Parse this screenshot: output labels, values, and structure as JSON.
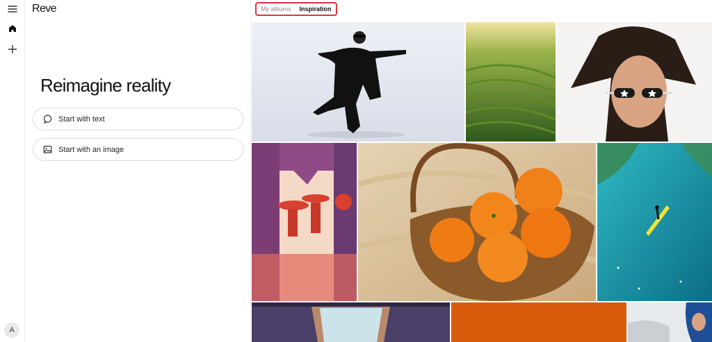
{
  "app": {
    "brand": "Reve"
  },
  "rail": {
    "items": [
      {
        "name": "menu",
        "icon": "menu-icon"
      },
      {
        "name": "home",
        "icon": "home-icon"
      },
      {
        "name": "new",
        "icon": "plus-icon"
      }
    ],
    "avatar_initial": "A"
  },
  "panel": {
    "heading": "Reimagine reality",
    "start_text_label": "Start with text",
    "start_image_label": "Start with an image"
  },
  "main": {
    "tabs": [
      {
        "label": "My albums",
        "active": false
      },
      {
        "label": "Inspiration",
        "active": true
      }
    ],
    "gallery": [
      {
        "subject": "blindfolded dancer in black coat"
      },
      {
        "subject": "green rice terraces"
      },
      {
        "subject": "woman with star sunglasses"
      },
      {
        "subject": "red umbrellas illustration"
      },
      {
        "subject": "oranges in wicker basket on sand"
      },
      {
        "subject": "paddleboarder in turquoise sea"
      },
      {
        "subject": "surreal doorway painting"
      },
      {
        "subject": "orange color block"
      },
      {
        "subject": "snowy figure in blue hood"
      }
    ]
  },
  "colors": {
    "accent_outline": "#d9363e"
  }
}
